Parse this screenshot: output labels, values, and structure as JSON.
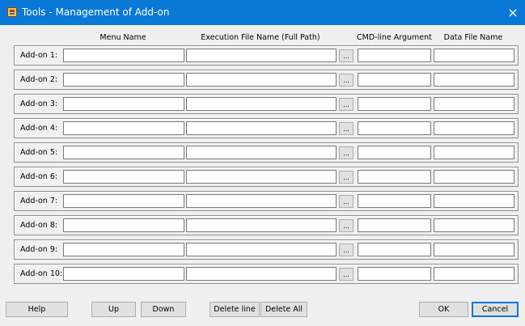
{
  "window": {
    "title": "Tools - Management of Add-on",
    "close_icon": "×"
  },
  "columns": {
    "menu_name": "Menu Name",
    "exec_path": "Execution File Name (Full Path)",
    "cmd_arg": "CMD-line Argument",
    "data_file": "Data File Name"
  },
  "addons": [
    {
      "label": "Add-on 1:",
      "menu_name": "",
      "exec_path": "",
      "cmd_arg": "",
      "data_file": ""
    },
    {
      "label": "Add-on 2:",
      "menu_name": "",
      "exec_path": "",
      "cmd_arg": "",
      "data_file": ""
    },
    {
      "label": "Add-on 3:",
      "menu_name": "",
      "exec_path": "",
      "cmd_arg": "",
      "data_file": ""
    },
    {
      "label": "Add-on 4:",
      "menu_name": "",
      "exec_path": "",
      "cmd_arg": "",
      "data_file": ""
    },
    {
      "label": "Add-on 5:",
      "menu_name": "",
      "exec_path": "",
      "cmd_arg": "",
      "data_file": ""
    },
    {
      "label": "Add-on 6:",
      "menu_name": "",
      "exec_path": "",
      "cmd_arg": "",
      "data_file": ""
    },
    {
      "label": "Add-on 7:",
      "menu_name": "",
      "exec_path": "",
      "cmd_arg": "",
      "data_file": ""
    },
    {
      "label": "Add-on 8:",
      "menu_name": "",
      "exec_path": "",
      "cmd_arg": "",
      "data_file": ""
    },
    {
      "label": "Add-on 9:",
      "menu_name": "",
      "exec_path": "",
      "cmd_arg": "",
      "data_file": ""
    },
    {
      "label": "Add-on 10:",
      "menu_name": "",
      "exec_path": "",
      "cmd_arg": "",
      "data_file": ""
    }
  ],
  "browse_label": "...",
  "buttons": {
    "help": "Help",
    "up": "Up",
    "down": "Down",
    "delete_line": "Delete line",
    "delete_all": "Delete All",
    "ok": "OK",
    "cancel": "Cancel"
  },
  "colors": {
    "titlebar": "#0a78d7",
    "dialog_bg": "#f0f0f0",
    "focus_border": "#0078d7"
  },
  "icons": {
    "app": "app-icon",
    "close": "close-icon"
  }
}
